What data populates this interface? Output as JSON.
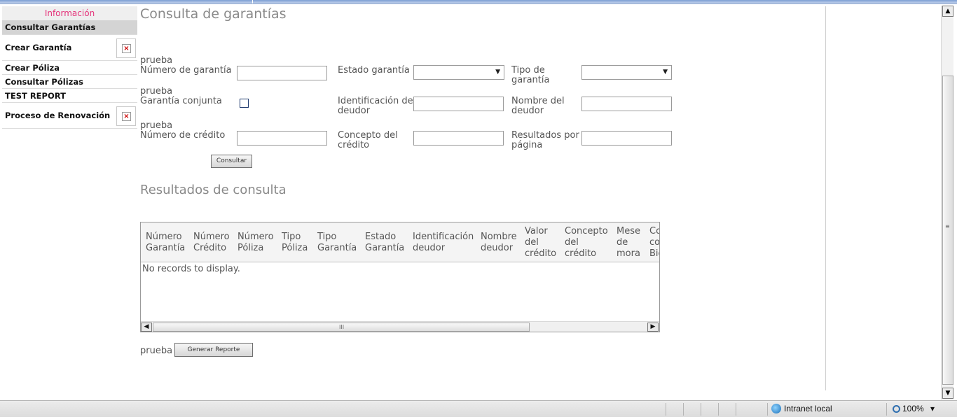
{
  "sidebar": {
    "header": "Información",
    "items": [
      {
        "label": "Consultar Garantías"
      },
      {
        "label": "Crear Garantía"
      },
      {
        "label": "Crear Póliza"
      },
      {
        "label": "Consultar Pólizas"
      },
      {
        "label": "TEST REPORT"
      },
      {
        "label": "Proceso de Renovación"
      }
    ],
    "close_glyph": "×"
  },
  "page": {
    "title": "Consulta de garantías"
  },
  "form": {
    "prefix": "prueba",
    "numero_garantia": {
      "label": "Número de garantía",
      "value": ""
    },
    "estado_garantia": {
      "label": "Estado garantía",
      "value": ""
    },
    "tipo_garantia": {
      "label": "Tipo de\ngarantía",
      "value": ""
    },
    "garantia_conjunta": {
      "label": "Garantía conjunta",
      "checked": false
    },
    "identificacion_deudor": {
      "label": "Identificación del\ndeudor",
      "value": ""
    },
    "nombre_deudor": {
      "label": "Nombre del\ndeudor",
      "value": ""
    },
    "numero_credito": {
      "label": "Número de crédito",
      "value": ""
    },
    "concepto_credito": {
      "label": "Concepto del\ncrédito",
      "value": ""
    },
    "resultados_pagina": {
      "label": "Resultados por\npágina",
      "value": ""
    },
    "consultar_button": "Consultar"
  },
  "results": {
    "title": "Resultados de consulta",
    "columns": [
      "Número\nGarantía",
      "Número\nCrédito",
      "Número\nPóliza",
      "Tipo\nPóliza",
      "Tipo\nGarantía",
      "Estado\nGarantía",
      "Identificación\ndeudor",
      "Nombre\ndeudor",
      "Valor\ndel\ncrédito",
      "Concepto\ndel\ncrédito",
      "Mese\nde\nmora",
      "Co\nco\nBie"
    ],
    "empty_message": "No records to display.",
    "scroll_grip": "III"
  },
  "report": {
    "prefix": "prueba",
    "button": "Generar Reporte"
  },
  "statusbar": {
    "zone": "Intranet local",
    "zoom": "100%",
    "zoom_arrow": "▾"
  }
}
